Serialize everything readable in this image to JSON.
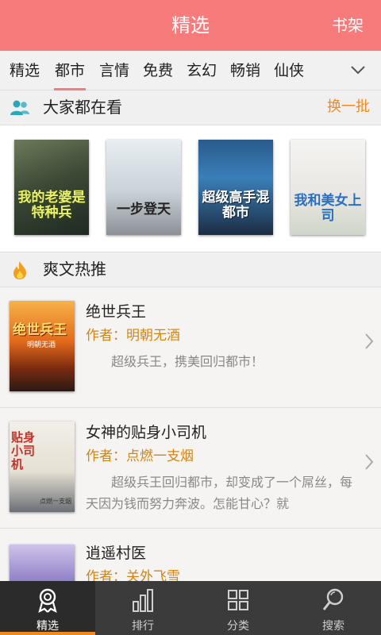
{
  "header": {
    "title": "精选",
    "shelf_label": "书架"
  },
  "tabs": [
    {
      "label": "精选"
    },
    {
      "label": "都市"
    },
    {
      "label": "言情"
    },
    {
      "label": "免费"
    },
    {
      "label": "玄幻"
    },
    {
      "label": "畅销"
    },
    {
      "label": "仙侠"
    }
  ],
  "active_tab": "都市",
  "section_popular": {
    "title": "大家都在看",
    "action": "换一批",
    "books": [
      {
        "cover_title": "我的老婆是特种兵"
      },
      {
        "cover_title": "一步登天"
      },
      {
        "cover_title": "超级高手混都市"
      },
      {
        "cover_title": "我和美女上司"
      }
    ]
  },
  "section_hot": {
    "title": "爽文热推",
    "books": [
      {
        "name": "绝世兵王",
        "author": "作者：明朝无酒",
        "desc": "超级兵王，携美回归都市！",
        "cover_title": "绝世兵王",
        "cover_author": "明朝无酒"
      },
      {
        "name": "女神的贴身小司机",
        "author": "作者：点燃一支烟",
        "desc": "超级兵王回归都市，却变成了一个屌丝，每天因为钱而努力奔波。怎能甘心？就",
        "cover_title": "贴身小司机",
        "cover_author": "点燃一支烟"
      },
      {
        "name": "逍遥村医",
        "author": "作者：关外飞雪",
        "desc": "",
        "cover_title": "",
        "cover_author": ""
      }
    ]
  },
  "bottom_nav": [
    {
      "label": "精选",
      "icon": "badge-icon"
    },
    {
      "label": "排行",
      "icon": "bar-chart-icon"
    },
    {
      "label": "分类",
      "icon": "grid-icon"
    },
    {
      "label": "搜索",
      "icon": "search-icon"
    }
  ],
  "colors": {
    "brand": "#f87b7b",
    "accent": "#f0891f",
    "author": "#d18514"
  }
}
